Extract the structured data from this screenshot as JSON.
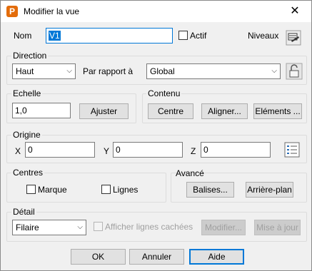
{
  "window": {
    "title": "Modifier la vue",
    "app_icon_letter": "P",
    "close_glyph": "✕"
  },
  "name": {
    "label": "Nom",
    "value": "V1",
    "actif_label": "Actif",
    "actif_checked": false,
    "niveaux_label": "Niveaux"
  },
  "direction": {
    "title": "Direction",
    "value": "Haut",
    "relative_label": "Par rapport à",
    "relative_value": "Global"
  },
  "echelle": {
    "title": "Echelle",
    "value": "1,0",
    "adjust_label": "Ajuster"
  },
  "contenu": {
    "title": "Contenu",
    "centre_label": "Centre",
    "aligner_label": "Aligner...",
    "elements_label": "Eléments ..."
  },
  "origine": {
    "title": "Origine",
    "x_label": "X",
    "x_value": "0",
    "y_label": "Y",
    "y_value": "0",
    "z_label": "Z",
    "z_value": "0"
  },
  "centres": {
    "title": "Centres",
    "marque_label": "Marque",
    "marque_checked": false,
    "lignes_label": "Lignes",
    "lignes_checked": false
  },
  "avance": {
    "title": "Avancé",
    "balises_label": "Balises...",
    "arriere_plan_label": "Arrière-plan"
  },
  "detail": {
    "title": "Détail",
    "value": "Filaire",
    "hidden_lines_label": "Afficher lignes cachées",
    "hidden_lines_checked": false,
    "modifier_label": "Modifier...",
    "mise_a_jour_label": "Mise à jour"
  },
  "footer": {
    "ok_label": "OK",
    "cancel_label": "Annuler",
    "help_label": "Aide"
  },
  "colors": {
    "accent": "#0078d7",
    "app_icon": "#e36c0a"
  }
}
